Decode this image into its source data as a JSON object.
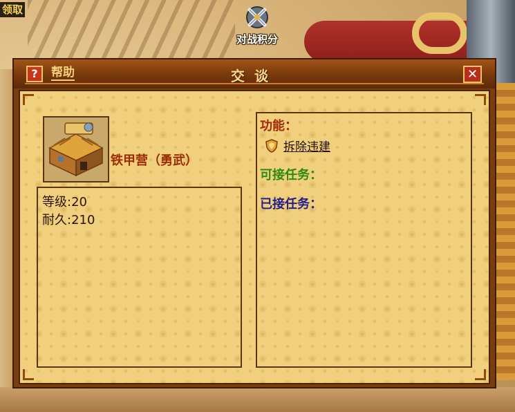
{
  "hud": {
    "reward_label": "领取",
    "battle_score_label": "对战积分",
    "battle_score_icon": "crossed-swords-icon"
  },
  "dialog": {
    "help_label": "帮助",
    "help_icon": "?",
    "title": "交谈",
    "close_icon": "✕"
  },
  "building": {
    "image": "barracks-building-icon",
    "name": "铁甲营（勇武）",
    "stats": [
      {
        "label": "等级",
        "value": "20"
      },
      {
        "label": "耐久",
        "value": "210"
      }
    ]
  },
  "functions": {
    "title": "功能：",
    "items": [
      {
        "icon": "shield-icon",
        "label": "拆除违建"
      }
    ],
    "available_tasks_title": "可接任务：",
    "accepted_tasks_title": "已接任务："
  },
  "colors": {
    "dialog_frame": "#7a3d10",
    "content_bg": "#f0cf7d",
    "function_title": "#a12a0b",
    "available_tasks": "#2e8a12",
    "accepted_tasks": "#231e8a",
    "building_name": "#9b2e08"
  }
}
